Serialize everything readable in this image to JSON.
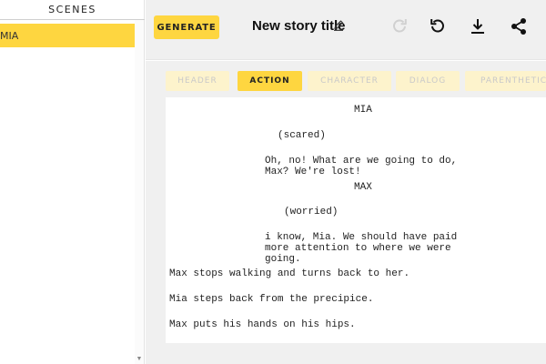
{
  "sidebar": {
    "header": "SCENES",
    "scenes": [
      {
        "label": "MIA"
      }
    ]
  },
  "toolbar": {
    "generate_label": "GENERATE",
    "story_title": "New story title",
    "icons": [
      "pencil-icon",
      "redo-icon",
      "undo-icon",
      "download-icon",
      "share-icon"
    ]
  },
  "tabs": [
    {
      "label": "HEADER",
      "active": false
    },
    {
      "label": "ACTION",
      "active": true
    },
    {
      "label": "CHARACTER",
      "active": false
    },
    {
      "label": "DIALOG",
      "active": false
    },
    {
      "label": "PARENTHETICAL",
      "active": false
    }
  ],
  "script": {
    "lines": [
      {
        "type": "character",
        "text": "MIA"
      },
      {
        "type": "parenthetical",
        "text": "(scared)"
      },
      {
        "type": "dialog",
        "text": "Oh, no! What are we going to do,"
      },
      {
        "type": "dialog",
        "text": "Max? We're lost!"
      },
      {
        "type": "character",
        "text": "MAX"
      },
      {
        "type": "parenthetical",
        "text": "(worried)"
      },
      {
        "type": "dialog",
        "text": "i know, Mia. We should have paid"
      },
      {
        "type": "dialog",
        "text": "more attention to where we were"
      },
      {
        "type": "dialog",
        "text": "going."
      },
      {
        "type": "action",
        "text": "Max stops walking and turns back to her."
      },
      {
        "type": "action",
        "text": "Mia steps back from the precipice."
      },
      {
        "type": "action",
        "text": "Max puts his hands on his hips."
      }
    ]
  },
  "colors": {
    "accent": "#fed640",
    "tab_inactive": "#fdf3cc",
    "background": "#f0f0f0"
  }
}
